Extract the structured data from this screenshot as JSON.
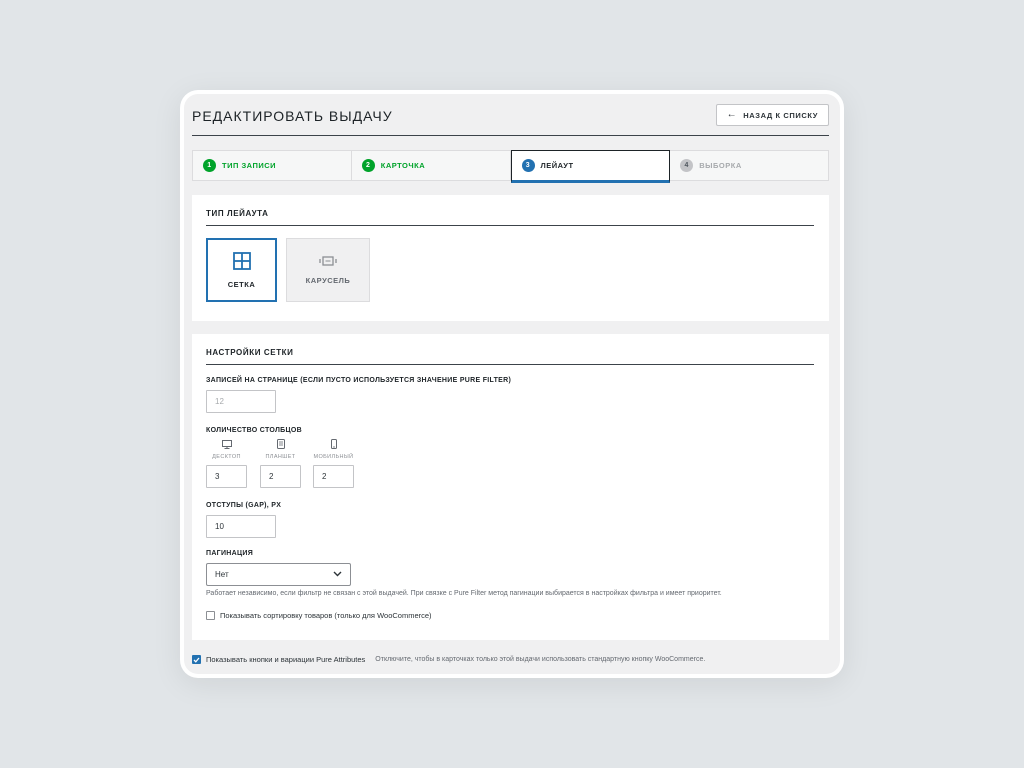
{
  "header": {
    "title": "Редактировать выдачу",
    "back_label": "Назад к списку"
  },
  "steps": [
    {
      "num": "1",
      "label": "Тип записи",
      "state": "done"
    },
    {
      "num": "2",
      "label": "Карточка",
      "state": "done"
    },
    {
      "num": "3",
      "label": "Лейаут",
      "state": "active"
    },
    {
      "num": "4",
      "label": "Выборка",
      "state": "pending"
    }
  ],
  "layout_type": {
    "title": "Тип лейаута",
    "options": [
      {
        "label": "Сетка",
        "icon": "grid-icon",
        "selected": true
      },
      {
        "label": "Карусель",
        "icon": "carousel-icon",
        "selected": false
      }
    ]
  },
  "grid_settings": {
    "title": "Настройки сетки",
    "per_page_label": "Записей на странице (если пусто используется значение Pure Filter)",
    "per_page_placeholder": "12",
    "columns_label": "Количество столбцов",
    "columns": [
      {
        "device": "Десктоп",
        "icon": "desktop-icon",
        "value": "3"
      },
      {
        "device": "Планшет",
        "icon": "tablet-icon",
        "value": "2"
      },
      {
        "device": "Мобильный",
        "icon": "mobile-icon",
        "value": "2"
      }
    ],
    "gap_label": "Отступы (gap), px",
    "gap_value": "10",
    "pagination_label": "Пагинация",
    "pagination_value": "Нет",
    "pagination_help": "Работает независимо, если фильтр не связан с этой выдачей. При связке с Pure Filter метод пагинации выбирается в настройках фильтра и имеет приоритет.",
    "show_sorting_label": "Показывать сортировку товаров (только для WooCommerce)",
    "show_sorting_checked": false
  },
  "bottom": {
    "pure_attributes_label": "Показывать кнопки и вариации Pure Attributes",
    "pure_attributes_checked": true,
    "pure_attributes_hint": "Отключите, чтобы в карточках только этой выдачи использовать стандартную кнопку WooCommerce."
  },
  "colors": {
    "accent": "#2271b1",
    "done": "#00a32a",
    "background": "#e1e5e8"
  }
}
